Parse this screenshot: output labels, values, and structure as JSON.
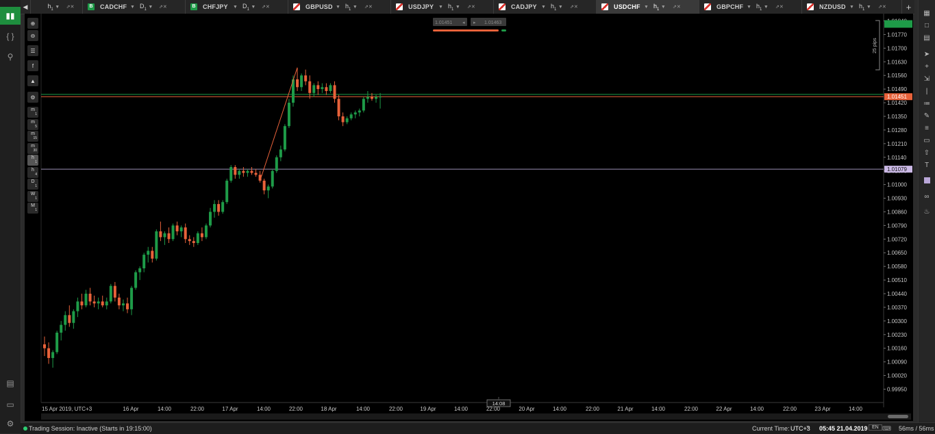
{
  "tabs": [
    {
      "symbol": "",
      "timeframe": "h",
      "tf_sub": "1",
      "direction": "none",
      "active": false
    },
    {
      "symbol": "CADCHF",
      "timeframe": "D",
      "tf_sub": "1",
      "direction": "buy",
      "active": false
    },
    {
      "symbol": "CHFJPY",
      "timeframe": "D",
      "tf_sub": "1",
      "direction": "buy",
      "active": false
    },
    {
      "symbol": "GBPUSD",
      "timeframe": "h",
      "tf_sub": "1",
      "direction": "sell",
      "active": false
    },
    {
      "symbol": "USDJPY",
      "timeframe": "h",
      "tf_sub": "1",
      "direction": "sell",
      "active": false
    },
    {
      "symbol": "CADJPY",
      "timeframe": "h",
      "tf_sub": "1",
      "direction": "sell",
      "active": false
    },
    {
      "symbol": "USDCHF",
      "timeframe": "h",
      "tf_sub": "1",
      "direction": "sell",
      "active": true
    },
    {
      "symbol": "GBPCHF",
      "timeframe": "h",
      "tf_sub": "1",
      "direction": "sell",
      "active": false
    },
    {
      "symbol": "NZDUSD",
      "timeframe": "h",
      "tf_sub": "1",
      "direction": "sell",
      "active": false
    }
  ],
  "tab_buy_letter": "B",
  "toolbox": {
    "timeframes": [
      [
        "m",
        "1"
      ],
      [
        "m",
        "5"
      ],
      [
        "m",
        "15"
      ],
      [
        "m",
        "30"
      ],
      [
        "h",
        "1"
      ],
      [
        "h",
        "4"
      ],
      [
        "D",
        "1"
      ],
      [
        "W",
        "1"
      ],
      [
        "M",
        "1"
      ]
    ],
    "active_timeframe": "h1"
  },
  "quick_trade": {
    "sell_price": "1.01451",
    "buy_price": "1.01463"
  },
  "pips_label": "25 pips",
  "price_axis": {
    "ticks": [
      "1.01840",
      "1.01770",
      "1.01700",
      "1.01630",
      "1.01560",
      "1.01490",
      "1.01420",
      "1.01350",
      "1.01280",
      "1.01210",
      "1.01140",
      "1.01070",
      "1.01000",
      "1.00930",
      "1.00860",
      "1.00790",
      "1.00720",
      "1.00650",
      "1.00580",
      "1.00510",
      "1.00440",
      "1.00370",
      "1.00300",
      "1.00230",
      "1.00160",
      "1.00090",
      "1.00020",
      "0.99950"
    ],
    "current_bid": "1.01451",
    "top_flag": "1.01840",
    "hline_label": "1.01079"
  },
  "time_axis": {
    "labels": [
      "15 Apr 2019, UTC+3",
      "16 Apr",
      "14:00",
      "22:00",
      "17 Apr",
      "14:00",
      "22:00",
      "18 Apr",
      "14:00",
      "22:00",
      "19 Apr",
      "14:00",
      "22:00",
      "20 Apr",
      "14:00",
      "22:00",
      "21 Apr",
      "14:00",
      "22:00",
      "22 Apr",
      "14:00",
      "22:00",
      "23 Apr",
      "14:00"
    ],
    "cursor_time": "14:08"
  },
  "colors": {
    "bull": "#1e9b48",
    "bear": "#e8623a",
    "hline": "#9d8fb5",
    "bid": "#e8623a",
    "ask": "#1e9b48"
  },
  "chart_data": {
    "type": "candlestick",
    "symbol": "USDCHF",
    "timeframe": "h1",
    "ylim": [
      0.999,
      1.0188
    ],
    "horizontal_line": 1.01079,
    "bid": 1.01451,
    "ask": 1.01463,
    "candles": [
      [
        1.0018,
        1.0022,
        1.0012,
        1.0016
      ],
      [
        1.0016,
        1.0019,
        1.0008,
        1.0011
      ],
      [
        1.0011,
        1.0015,
        1.0006,
        1.0014
      ],
      [
        1.0014,
        1.0025,
        1.0013,
        1.0024
      ],
      [
        1.0024,
        1.003,
        1.002,
        1.0028
      ],
      [
        1.0028,
        1.0035,
        1.0025,
        1.0033
      ],
      [
        1.0033,
        1.0038,
        1.0027,
        1.0029
      ],
      [
        1.0029,
        1.0036,
        1.0026,
        1.0035
      ],
      [
        1.0035,
        1.0042,
        1.0032,
        1.004
      ],
      [
        1.004,
        1.0044,
        1.0036,
        1.0038
      ],
      [
        1.0038,
        1.0046,
        1.0037,
        1.0044
      ],
      [
        1.0044,
        1.0047,
        1.0038,
        1.004
      ],
      [
        1.004,
        1.0043,
        1.0037,
        1.0039
      ],
      [
        1.0039,
        1.0042,
        1.0036,
        1.004
      ],
      [
        1.004,
        1.0043,
        1.0037,
        1.0038
      ],
      [
        1.0038,
        1.0042,
        1.0036,
        1.004
      ],
      [
        1.004,
        1.0049,
        1.0039,
        1.0048
      ],
      [
        1.0048,
        1.005,
        1.004,
        1.0042
      ],
      [
        1.0042,
        1.0044,
        1.0036,
        1.0038
      ],
      [
        1.0038,
        1.0041,
        1.0035,
        1.0039
      ],
      [
        1.0039,
        1.0042,
        1.0034,
        1.0036
      ],
      [
        1.0036,
        1.0048,
        1.0033,
        1.0047
      ],
      [
        1.0047,
        1.0056,
        1.0046,
        1.0055
      ],
      [
        1.0055,
        1.0058,
        1.0051,
        1.0057
      ],
      [
        1.0057,
        1.0065,
        1.0055,
        1.0064
      ],
      [
        1.0064,
        1.0068,
        1.006,
        1.0066
      ],
      [
        1.0066,
        1.0068,
        1.006,
        1.0062
      ],
      [
        1.0062,
        1.0077,
        1.0061,
        1.0076
      ],
      [
        1.0076,
        1.0081,
        1.0071,
        1.0073
      ],
      [
        1.0073,
        1.0076,
        1.0069,
        1.0075
      ],
      [
        1.0075,
        1.0078,
        1.007,
        1.0072
      ],
      [
        1.0072,
        1.008,
        1.0071,
        1.0079
      ],
      [
        1.0079,
        1.0081,
        1.0074,
        1.0076
      ],
      [
        1.0076,
        1.0079,
        1.0073,
        1.0078
      ],
      [
        1.0078,
        1.008,
        1.007,
        1.0072
      ],
      [
        1.0072,
        1.0074,
        1.0069,
        1.0071
      ],
      [
        1.0071,
        1.0073,
        1.0068,
        1.007
      ],
      [
        1.007,
        1.0076,
        1.0069,
        1.0075
      ],
      [
        1.0075,
        1.0078,
        1.0071,
        1.0073
      ],
      [
        1.0073,
        1.008,
        1.0072,
        1.0079
      ],
      [
        1.0079,
        1.0088,
        1.0078,
        1.0086
      ],
      [
        1.0086,
        1.0092,
        1.0083,
        1.009
      ],
      [
        1.009,
        1.0092,
        1.0084,
        1.0086
      ],
      [
        1.0086,
        1.0092,
        1.0085,
        1.0091
      ],
      [
        1.0091,
        1.0103,
        1.009,
        1.0102
      ],
      [
        1.0102,
        1.011,
        1.0101,
        1.0109
      ],
      [
        1.0109,
        1.011,
        1.0103,
        1.0105
      ],
      [
        1.0105,
        1.0108,
        1.0103,
        1.0107
      ],
      [
        1.0107,
        1.0109,
        1.0104,
        1.0106
      ],
      [
        1.0106,
        1.0108,
        1.0104,
        1.0107
      ],
      [
        1.0107,
        1.0109,
        1.0105,
        1.0106
      ],
      [
        1.0106,
        1.0108,
        1.0104,
        1.0105
      ],
      [
        1.0105,
        1.0107,
        1.0101,
        1.0102
      ],
      [
        1.0102,
        1.0103,
        1.0095,
        1.0097
      ],
      [
        1.0097,
        1.01,
        1.0093,
        1.0099
      ],
      [
        1.0099,
        1.0108,
        1.0098,
        1.0107
      ],
      [
        1.0107,
        1.0115,
        1.0106,
        1.0114
      ],
      [
        1.0114,
        1.012,
        1.0112,
        1.0118
      ],
      [
        1.0118,
        1.0131,
        1.0117,
        1.013
      ],
      [
        1.013,
        1.0144,
        1.0129,
        1.0142
      ],
      [
        1.0142,
        1.0156,
        1.014,
        1.0154
      ],
      [
        1.0154,
        1.016,
        1.0148,
        1.015
      ],
      [
        1.015,
        1.0157,
        1.0148,
        1.0156
      ],
      [
        1.0156,
        1.0159,
        1.0151,
        1.0153
      ],
      [
        1.0153,
        1.0156,
        1.0144,
        1.0147
      ],
      [
        1.0147,
        1.0152,
        1.0145,
        1.0151
      ],
      [
        1.0151,
        1.0153,
        1.0146,
        1.0149
      ],
      [
        1.0149,
        1.0152,
        1.0147,
        1.015
      ],
      [
        1.015,
        1.0152,
        1.0146,
        1.0148
      ],
      [
        1.0148,
        1.0152,
        1.0147,
        1.0151
      ],
      [
        1.0151,
        1.0153,
        1.0142,
        1.0144
      ],
      [
        1.0144,
        1.0146,
        1.0133,
        1.0135
      ],
      [
        1.0135,
        1.0137,
        1.013,
        1.0132
      ],
      [
        1.0132,
        1.0135,
        1.0131,
        1.0134
      ],
      [
        1.0134,
        1.0137,
        1.0133,
        1.0136
      ],
      [
        1.0136,
        1.0138,
        1.0134,
        1.0137
      ],
      [
        1.0137,
        1.0139,
        1.0135,
        1.0138
      ],
      [
        1.0138,
        1.0145,
        1.0137,
        1.0144
      ],
      [
        1.0144,
        1.0148,
        1.0142,
        1.0145
      ],
      [
        1.0145,
        1.0147,
        1.0143,
        1.0144
      ],
      [
        1.0144,
        1.0146,
        1.0142,
        1.0145
      ],
      [
        1.0145,
        1.0147,
        1.0139,
        1.01451
      ]
    ]
  },
  "status": {
    "session": "Trading Session: Inactive (Starts in 19:15:00)",
    "current_time_label": "Current Time:",
    "timezone": "UTC+3",
    "datetime": "05:45 21.04.2019",
    "lang": "EN",
    "latency": "56ms  /  56ms"
  }
}
